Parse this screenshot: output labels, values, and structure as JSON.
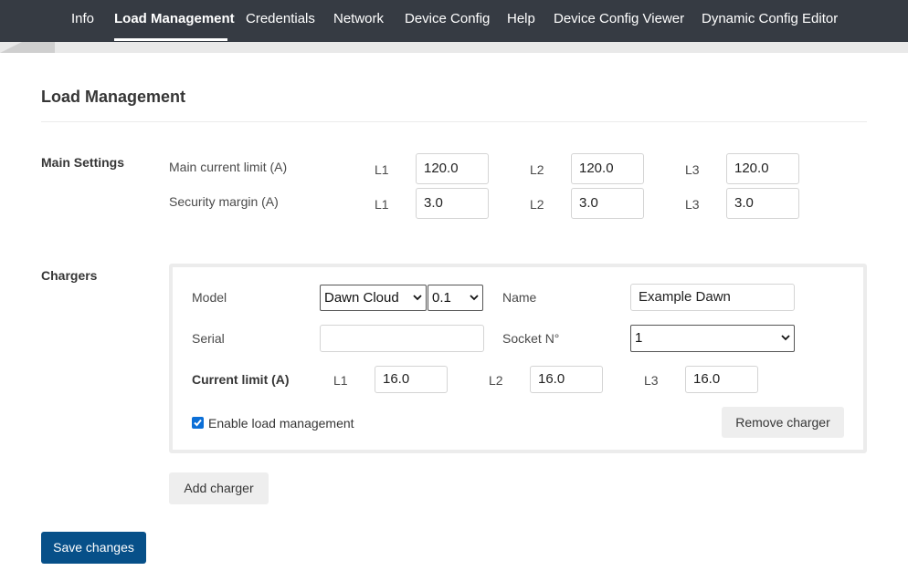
{
  "nav": {
    "items": [
      {
        "label": "Info"
      },
      {
        "label": "Load Management",
        "active": true
      },
      {
        "label": "Credentials"
      },
      {
        "label": "Network"
      },
      {
        "label": "Device Config"
      },
      {
        "label": "Help"
      },
      {
        "label": "Device Config Viewer"
      },
      {
        "label": "Dynamic Config Editor"
      }
    ]
  },
  "page": {
    "title": "Load Management"
  },
  "main_settings": {
    "section_label": "Main Settings",
    "rows": [
      {
        "label": "Main current limit (A)",
        "phases": [
          {
            "name": "L1",
            "value": "120.0"
          },
          {
            "name": "L2",
            "value": "120.0"
          },
          {
            "name": "L3",
            "value": "120.0"
          }
        ]
      },
      {
        "label": "Security margin (A)",
        "phases": [
          {
            "name": "L1",
            "value": "3.0"
          },
          {
            "name": "L2",
            "value": "3.0"
          },
          {
            "name": "L3",
            "value": "3.0"
          }
        ]
      }
    ]
  },
  "chargers": {
    "section_label": "Chargers",
    "items": [
      {
        "model_label": "Model",
        "model_value": "Dawn Cloud",
        "version_value": "0.1",
        "name_label": "Name",
        "name_value": "Example Dawn",
        "serial_label": "Serial",
        "serial_value": "",
        "socket_label": "Socket N°",
        "socket_value": "1",
        "current_limit_label": "Current limit (A)",
        "phases": [
          {
            "name": "L1",
            "value": "16.0"
          },
          {
            "name": "L2",
            "value": "16.0"
          },
          {
            "name": "L3",
            "value": "16.0"
          }
        ],
        "enable_label": "Enable load management",
        "enable_checked": true,
        "remove_label": "Remove charger"
      }
    ],
    "add_label": "Add charger"
  },
  "save_label": "Save changes",
  "colors": {
    "nav_bg": "#363b43",
    "primary": "#075089",
    "checkbox": "#0b6fd7"
  }
}
